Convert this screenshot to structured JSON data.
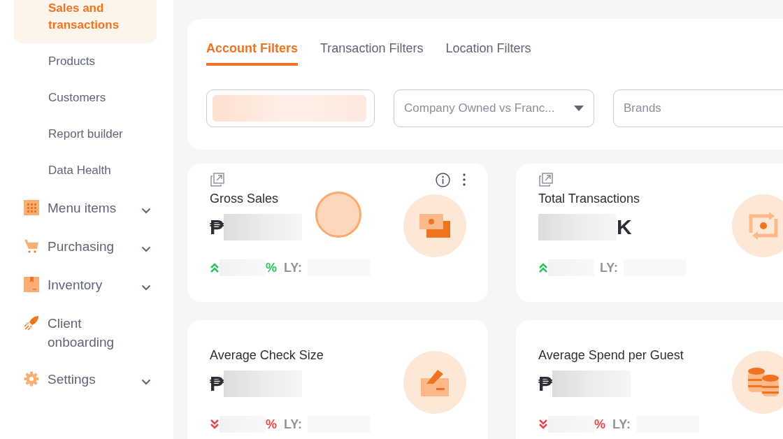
{
  "sidebar": {
    "sub_items": [
      {
        "label": "Sales and transactions",
        "selected": true
      },
      {
        "label": "Products",
        "selected": false
      },
      {
        "label": "Customers",
        "selected": false
      },
      {
        "label": "Report builder",
        "selected": false
      },
      {
        "label": "Data Health",
        "selected": false
      }
    ],
    "items": [
      {
        "label": "Menu items",
        "kind": "grid",
        "expandable": true
      },
      {
        "label": "Purchasing",
        "kind": "cart",
        "expandable": true
      },
      {
        "label": "Inventory",
        "kind": "box",
        "expandable": true
      },
      {
        "label": "Client onboarding",
        "kind": "rocket",
        "expandable": false
      },
      {
        "label": "Settings",
        "kind": "gear",
        "expandable": true
      }
    ]
  },
  "filters": {
    "tabs": [
      {
        "label": "Account Filters",
        "selected": true
      },
      {
        "label": "Transaction Filters",
        "selected": false
      },
      {
        "label": "Location Filters",
        "selected": false
      }
    ],
    "fields": [
      {
        "kind": "redacted"
      },
      {
        "kind": "dropdown",
        "value": "Company Owned vs Franc..."
      },
      {
        "kind": "text",
        "placeholder": "Brands"
      }
    ]
  },
  "cards": [
    {
      "title": "Gross Sales",
      "expand": true,
      "info": true,
      "menu": true,
      "pointer": true,
      "prefix": "₱",
      "rising": true,
      "percent": "%",
      "ly": "LY:",
      "kind": "cash"
    },
    {
      "title": "Total Transactions",
      "expand": true,
      "info": false,
      "menu": false,
      "pointer": false,
      "suffix": "K",
      "rising": true,
      "ly": "LY:",
      "kind": "repeat"
    },
    {
      "title": "Average Check Size",
      "expand": false,
      "info": false,
      "menu": false,
      "pointer": false,
      "prefix": "₱",
      "rising": false,
      "percent": "%",
      "ly": "LY:",
      "kind": "receipt"
    },
    {
      "title": "Average Spend per Guest",
      "expand": false,
      "info": false,
      "menu": false,
      "pointer": false,
      "prefix": "₱",
      "rising": false,
      "percent": "%",
      "ly": "LY:",
      "kind": "coins"
    }
  ]
}
